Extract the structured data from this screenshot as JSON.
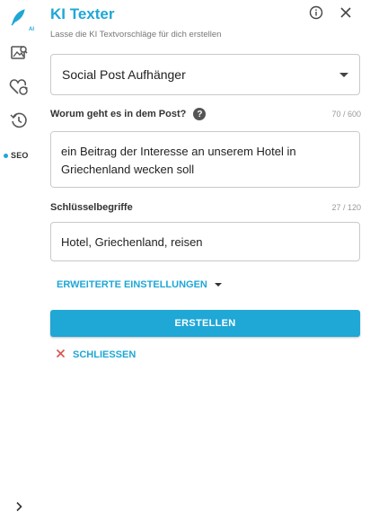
{
  "app": {
    "title": "KI Texter",
    "subtitle": "Lasse die KI Textvorschläge für dich erstellen"
  },
  "sidebar": {
    "items": [
      {
        "name": "ai-writer",
        "icon": "feather-ai-icon",
        "label": "AI"
      },
      {
        "name": "image-tool",
        "icon": "image-search-icon"
      },
      {
        "name": "favorites",
        "icon": "heart-refresh-icon"
      },
      {
        "name": "history",
        "icon": "history-icon"
      },
      {
        "name": "seo",
        "label": "SEO",
        "active": true
      }
    ],
    "expand_icon": "chevron-right-icon"
  },
  "header": {
    "info_icon": "info-icon",
    "close_icon": "close-icon"
  },
  "form": {
    "type_select": {
      "value": "Social Post Aufhänger"
    },
    "topic": {
      "label": "Worum geht es in dem Post?",
      "help": "?",
      "counter": "70 / 600",
      "value": "ein Beitrag der Interesse an unserem Hotel in Griechenland wecken soll"
    },
    "keywords": {
      "label": "Schlüsselbegriffe",
      "counter": "27 / 120",
      "value": "Hotel, Griechenland, reisen"
    },
    "advanced_label": "ERWEITERTE EINSTELLUNGEN",
    "submit_label": "ERSTELLEN",
    "close_label": "SCHLIESSEN"
  },
  "colors": {
    "accent": "#1fa7d6",
    "close_x": "#d9534f"
  }
}
